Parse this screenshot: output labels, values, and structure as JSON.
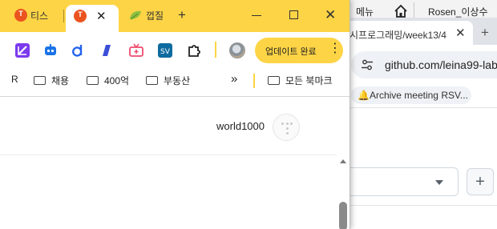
{
  "colors": {
    "chrome_yellow": "#fdd445",
    "tistory_orange": "#eb531f",
    "github_bg": "#f6f8fa"
  },
  "back_window": {
    "taskbar": {
      "menu_label": "메뉴",
      "home_icon": "home-icon",
      "user_label": "Rosen_이상수"
    },
    "tab": {
      "title": "시프로그래밍/week13/4",
      "close_icon": "close-icon"
    },
    "new_tab_label": "+",
    "address": {
      "url": "github.com/leina99-lab",
      "site_info_icon": "tune-icon"
    },
    "bookmarks": {
      "item_label": "🔔Archive meeting RSV...",
      "apps_icon": "apps-grid-icon"
    },
    "form": {
      "add_label": "+"
    }
  },
  "front_window": {
    "tabs": [
      {
        "title": "티스",
        "icon": "tistory-icon"
      },
      {
        "title": "",
        "icon": "tistory-icon",
        "close_label": "✕"
      },
      {
        "title": "껍질",
        "icon": "leaf-icon"
      }
    ],
    "new_tab_label": "+",
    "window_controls": {
      "minimize": "minimize-icon",
      "maximize": "maximize-icon",
      "close_label": "✕"
    },
    "toolbar": {
      "extensions": [
        "edit-ext-icon",
        "bot-ext-icon",
        "d-ext-icon",
        "slash-ext-icon",
        "tv-ext-icon",
        "sv-ext-icon",
        "puzzle-icon"
      ],
      "update_button_label": "업데이트 완료",
      "menu_label": "⋮"
    },
    "bookmarks": [
      {
        "label": "R"
      },
      {
        "label": "채용"
      },
      {
        "label": "400억"
      },
      {
        "label": "부동산"
      }
    ],
    "bookmarks_overflow_label": "»",
    "all_bookmarks_label": "모든 북마크",
    "page": {
      "blog_name": "world1000"
    }
  }
}
